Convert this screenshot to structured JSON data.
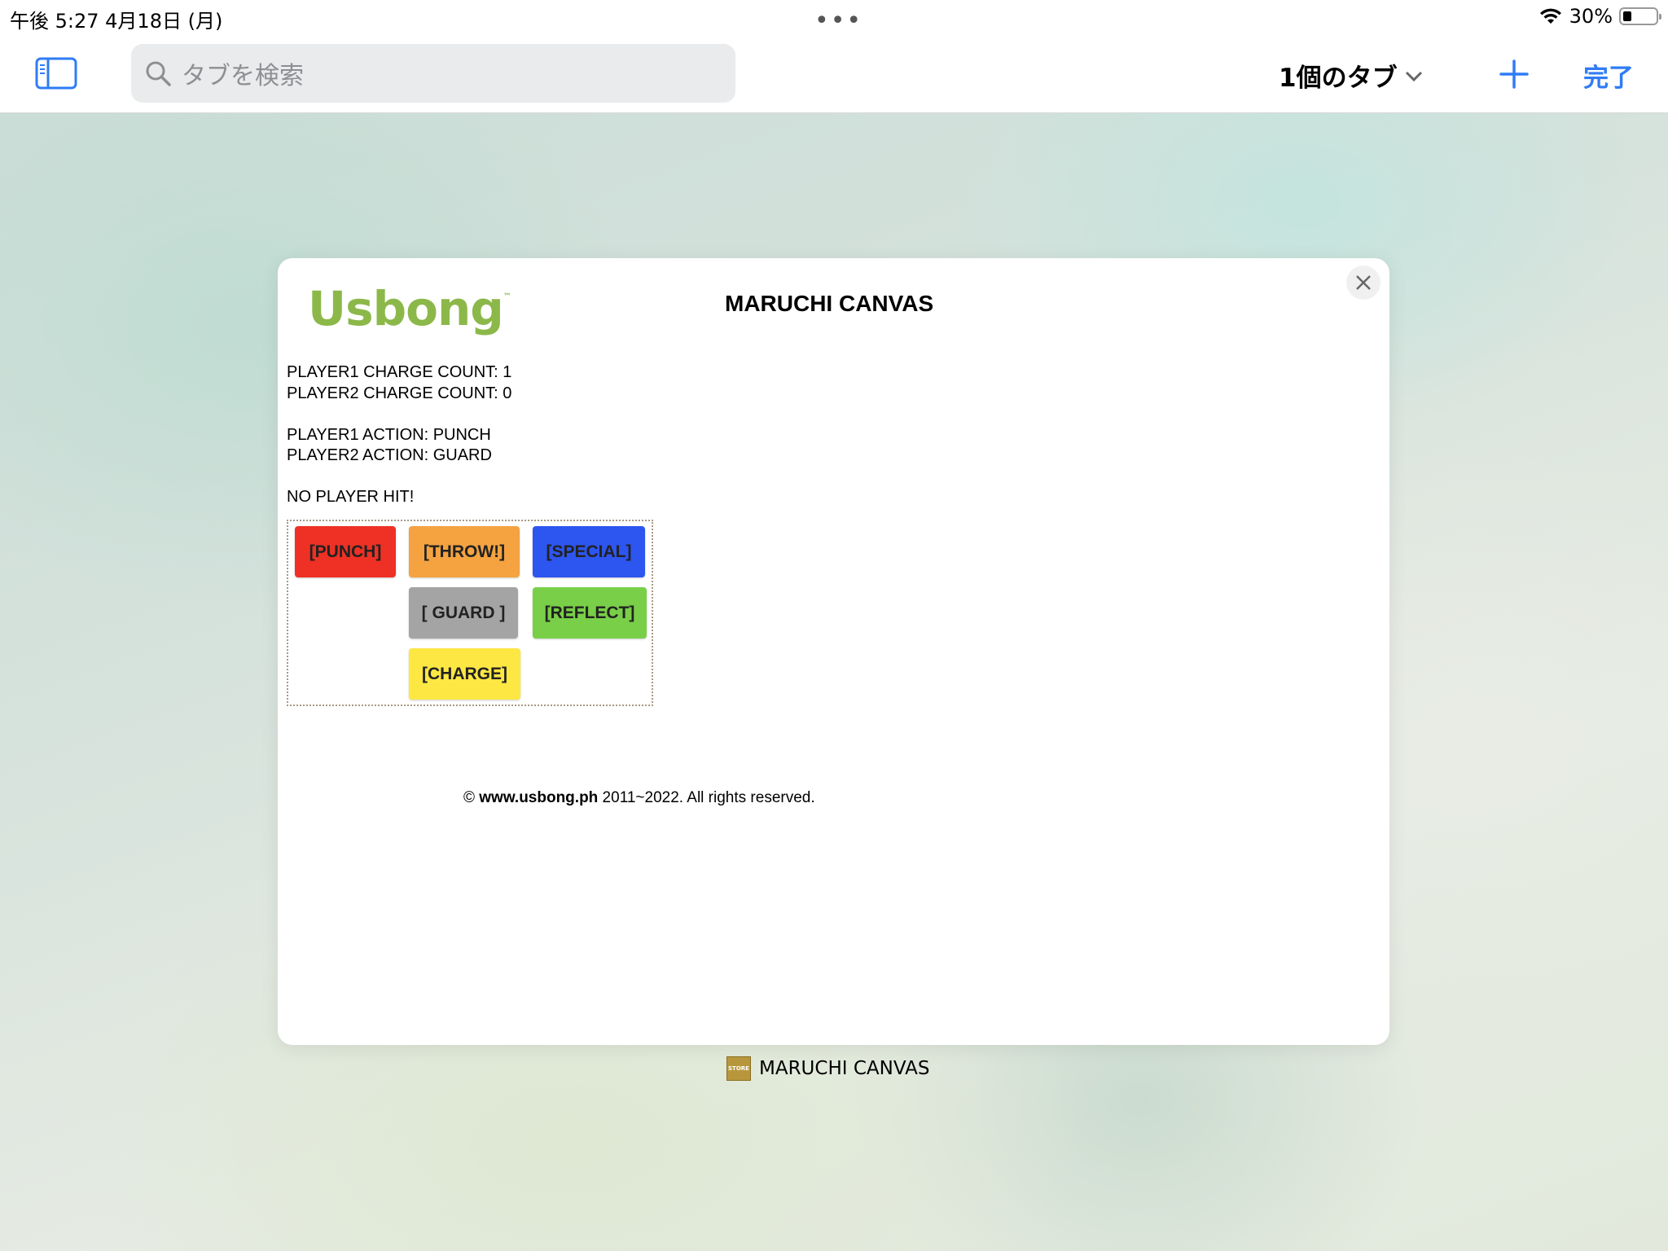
{
  "status_bar": {
    "time_date": "午後 5:27   4月18日 (月)",
    "dots": "•••",
    "battery": "30%"
  },
  "toolbar": {
    "search_placeholder": "タブを検索",
    "tab_count_label": "1個のタブ",
    "done_label": "完了"
  },
  "page": {
    "logo_text": "Usbong",
    "logo_tm": "™",
    "title": "MARUCHI CANVAS",
    "player1_charge": "PLAYER1 CHARGE COUNT: 1",
    "player2_charge": "PLAYER2 CHARGE COUNT: 0",
    "player1_action": "PLAYER1 ACTION: PUNCH",
    "player2_action": "PLAYER2 ACTION: GUARD",
    "hit_status": "NO PLAYER HIT!",
    "buttons": {
      "punch": "[PUNCH]",
      "throw": "[THROW!]",
      "special": "[SPECIAL]",
      "guard": "[ GUARD ]",
      "reflect": "[REFLECT]",
      "charge": "[CHARGE]"
    },
    "footer_copy": "© ",
    "footer_site": "www.usbong.ph",
    "footer_rest": " 2011~2022. All rights reserved."
  },
  "tab_label": {
    "favicon_text": "STORE",
    "title": "MARUCHI CANVAS"
  },
  "colors": {
    "punch": "#ee3124",
    "throw": "#f4a340",
    "special": "#2d55f0",
    "guard": "#a4a4a4",
    "reflect": "#79cf48",
    "charge": "#fde743",
    "accent": "#2f7cf6",
    "logo": "#8cb84a"
  }
}
